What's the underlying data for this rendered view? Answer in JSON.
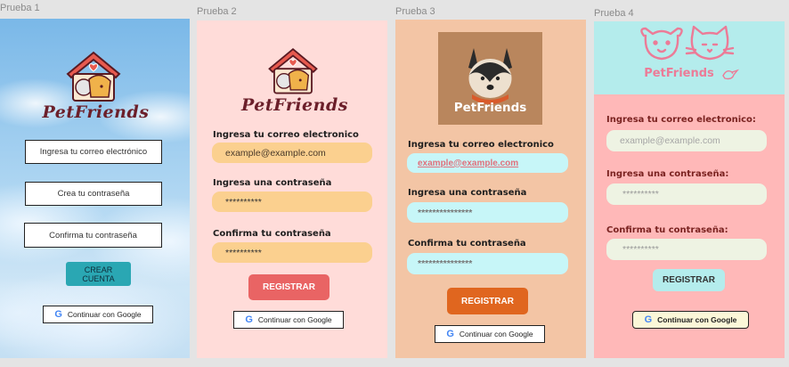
{
  "frames": [
    {
      "label": "Prueba 1",
      "logo_text": "PetFriends",
      "email_placeholder": "Ingresa tu correo electrónico",
      "password_placeholder": "Crea tu contraseña",
      "confirm_placeholder": "Confirma tu contraseña",
      "submit_label": "CREAR\nCUENTA",
      "google_label": "Continuar con Google"
    },
    {
      "label": "Prueba 2",
      "logo_text": "PetFriends",
      "email_label": "Ingresa tu correo electronico",
      "email_value": "example@example.com",
      "password_label": "Ingresa una contraseña",
      "password_value": "**********",
      "confirm_label": "Confirma tu contraseña",
      "confirm_value": "**********",
      "submit_label": "REGISTRAR",
      "google_label": "Continuar con Google"
    },
    {
      "label": "Prueba 3",
      "logo_text": "PetFriends",
      "email_label": "Ingresa tu correo electronico",
      "email_value": "example@example.com",
      "password_label": "Ingresa una contraseña",
      "password_value": "***************",
      "confirm_label": "Confirma tu contraseña",
      "confirm_value": "***************",
      "submit_label": "REGISTRAR",
      "google_label": "Continuar con Google"
    },
    {
      "label": "Prueba 4",
      "logo_text": "PetFriends",
      "email_label": "Ingresa tu correo electronico:",
      "email_placeholder": "example@example.com",
      "password_label": "Ingresa una contraseña:",
      "password_value": "**********",
      "confirm_label": "Confirma tu contraseña:",
      "confirm_value": "**********",
      "submit_label": "REGISTRAR",
      "google_label": "Continuar con Google"
    }
  ],
  "google_glyph": "G",
  "colors": {
    "canvas": "#e4e4e4",
    "frame1_sky": "#8fc4ec",
    "frame1_button": "#2aa7b3",
    "frame2_bg": "#ffdcd9",
    "frame2_input": "#fbd08f",
    "frame2_button": "#e96464",
    "frame3_bg": "#f3c5a5",
    "frame3_input": "#c7f6f8",
    "frame3_button": "#e0661f",
    "frame4_header": "#b4ecec",
    "frame4_body": "#ffb8b8",
    "frame4_input": "#eef3e3",
    "frame4_button": "#b4ecec",
    "brand_maroon": "#6b1f2a",
    "brand_pink": "#ec7b97"
  }
}
